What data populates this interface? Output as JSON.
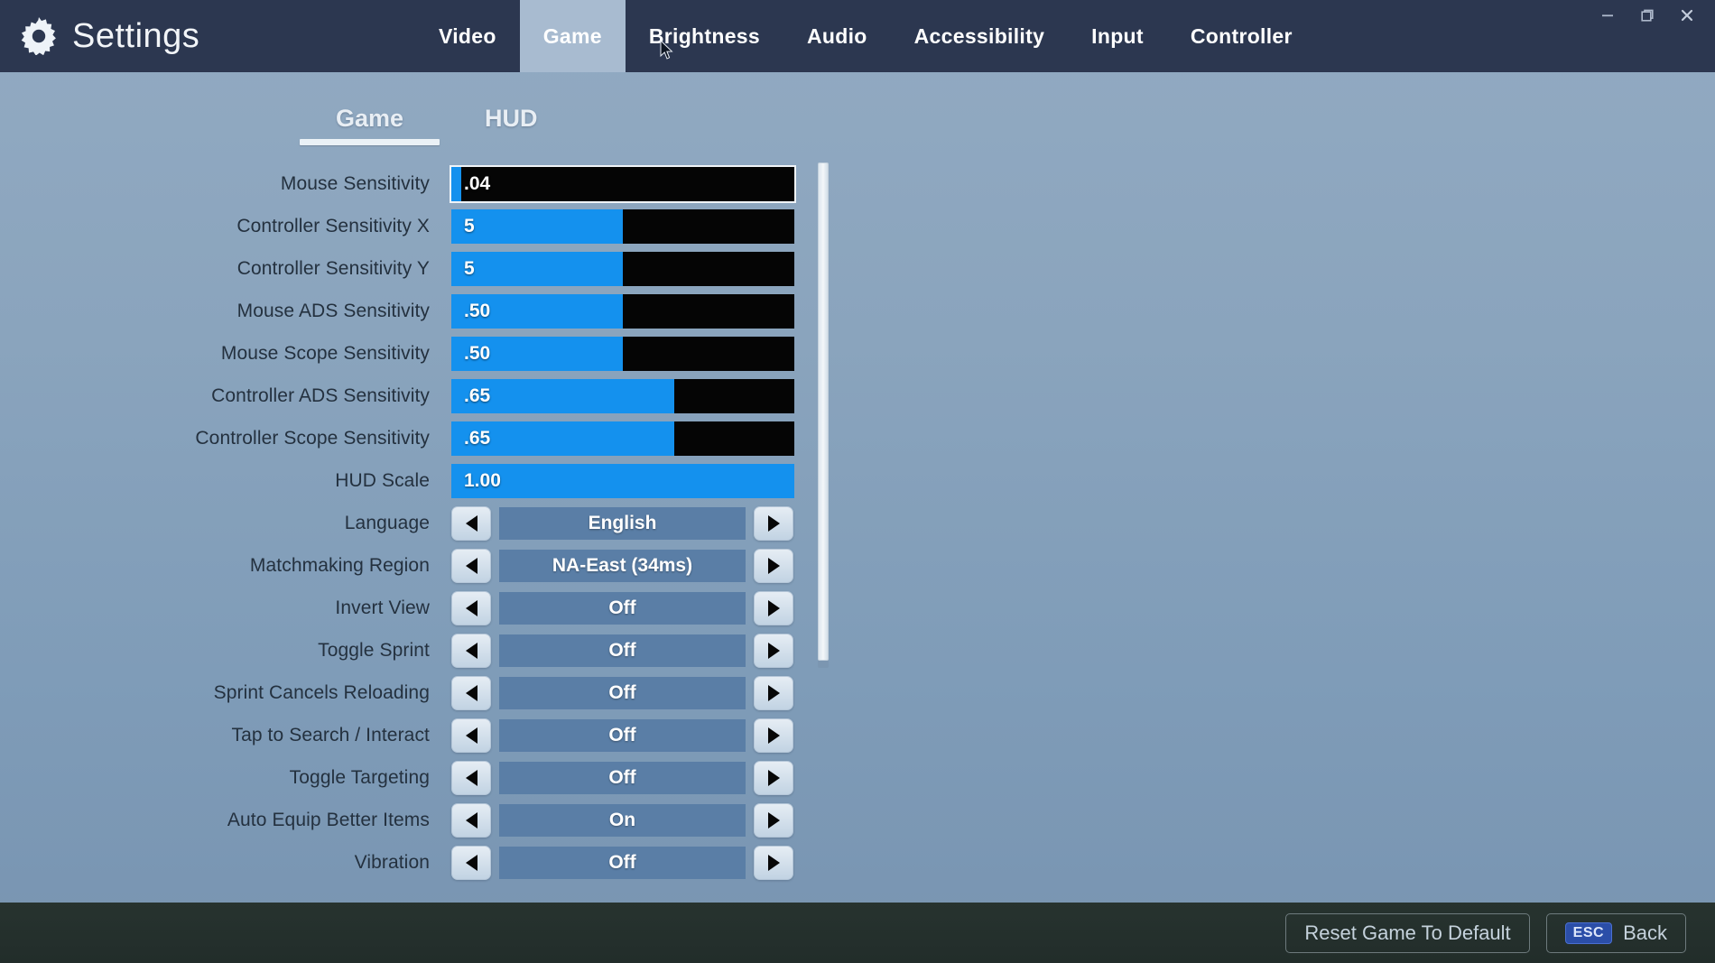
{
  "window": {
    "controls": [
      {
        "name": "minimize",
        "glyph": "minimize-icon"
      },
      {
        "name": "maximize",
        "glyph": "maximize-icon"
      },
      {
        "name": "close",
        "glyph": "close-icon"
      }
    ]
  },
  "header": {
    "icon": "gear-icon",
    "title": "Settings",
    "tabs": [
      {
        "label": "Video",
        "active": false
      },
      {
        "label": "Game",
        "active": true
      },
      {
        "label": "Brightness",
        "active": false
      },
      {
        "label": "Audio",
        "active": false
      },
      {
        "label": "Accessibility",
        "active": false
      },
      {
        "label": "Input",
        "active": false
      },
      {
        "label": "Controller",
        "active": false
      }
    ]
  },
  "subtabs": [
    {
      "label": "Game",
      "active": true
    },
    {
      "label": "HUD",
      "active": false
    }
  ],
  "settings": [
    {
      "label": "Mouse Sensitivity",
      "type": "slider",
      "value": ".04",
      "fill_pct": 3,
      "focused": true
    },
    {
      "label": "Controller Sensitivity X",
      "type": "slider",
      "value": "5",
      "fill_pct": 50,
      "focused": false
    },
    {
      "label": "Controller Sensitivity Y",
      "type": "slider",
      "value": "5",
      "fill_pct": 50,
      "focused": false
    },
    {
      "label": "Mouse ADS Sensitivity",
      "type": "slider",
      "value": ".50",
      "fill_pct": 50,
      "focused": false
    },
    {
      "label": "Mouse Scope Sensitivity",
      "type": "slider",
      "value": ".50",
      "fill_pct": 50,
      "focused": false
    },
    {
      "label": "Controller ADS Sensitivity",
      "type": "slider",
      "value": ".65",
      "fill_pct": 65,
      "focused": false
    },
    {
      "label": "Controller Scope Sensitivity",
      "type": "slider",
      "value": ".65",
      "fill_pct": 65,
      "focused": false
    },
    {
      "label": "HUD Scale",
      "type": "slider",
      "value": "1.00",
      "fill_pct": 100,
      "focused": false
    },
    {
      "label": "Language",
      "type": "selector",
      "value": "English"
    },
    {
      "label": "Matchmaking Region",
      "type": "selector",
      "value": "NA-East (34ms)"
    },
    {
      "label": "Invert View",
      "type": "selector",
      "value": "Off"
    },
    {
      "label": "Toggle Sprint",
      "type": "selector",
      "value": "Off"
    },
    {
      "label": "Sprint Cancels Reloading",
      "type": "selector",
      "value": "Off"
    },
    {
      "label": "Tap to Search / Interact",
      "type": "selector",
      "value": "Off"
    },
    {
      "label": "Toggle Targeting",
      "type": "selector",
      "value": "Off"
    },
    {
      "label": "Auto Equip Better Items",
      "type": "selector",
      "value": "On"
    },
    {
      "label": "Vibration",
      "type": "selector",
      "value": "Off"
    }
  ],
  "selector_arrows": {
    "prev": "triangle-left-icon",
    "next": "triangle-right-icon"
  },
  "footer": {
    "reset_label": "Reset Game To Default",
    "back_key": "ESC",
    "back_label": "Back"
  },
  "colors": {
    "topbar": "#2c3750",
    "active_tab": "#a8bbd0",
    "slider_fill": "#1491ee",
    "slider_track": "#050505",
    "selector_value": "#5a7ea6",
    "esc_badge": "#2b4ea8",
    "bottom_bar": "#27332f"
  }
}
